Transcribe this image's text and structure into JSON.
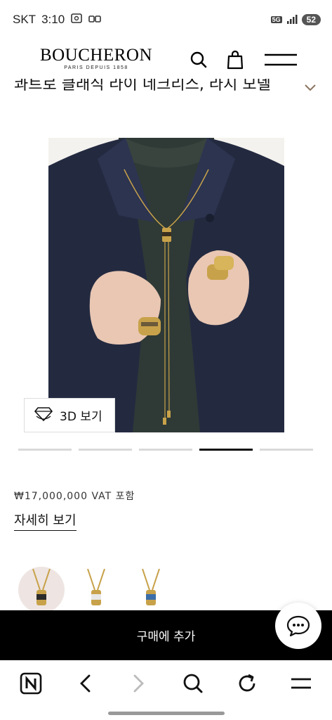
{
  "status_bar": {
    "carrier": "SKT",
    "time": "3:10",
    "network": "5G",
    "battery": "52"
  },
  "header": {
    "logo_main": "BOUCHERON",
    "logo_sub": "PARIS DEPUIS 1858",
    "icons": [
      "search-icon",
      "shopping-bag-icon",
      "menu-icon"
    ]
  },
  "product": {
    "title": "콰트로 클래식 라이 네크리스, 라지 모델",
    "view3d_label": "3D 보기",
    "price": "₩17,000,000 VAT 포함",
    "details_label": "자세히 보기",
    "carousel": {
      "count": 5,
      "active_index": 3
    },
    "variants": [
      {
        "name": "variant-classic",
        "accent": "#2b2b2b"
      },
      {
        "name": "variant-white",
        "accent": "#e8e8e8"
      },
      {
        "name": "variant-blue",
        "accent": "#3b6ea8"
      }
    ]
  },
  "cta": {
    "add_to_cart": "구매에 추가"
  },
  "colors": {
    "brand": "#000000",
    "background": "#ffffff",
    "gold": "#c8a24a"
  },
  "browser_nav": [
    "naver-home-icon",
    "back-icon",
    "forward-icon",
    "search-icon",
    "refresh-icon",
    "menu-icon"
  ]
}
